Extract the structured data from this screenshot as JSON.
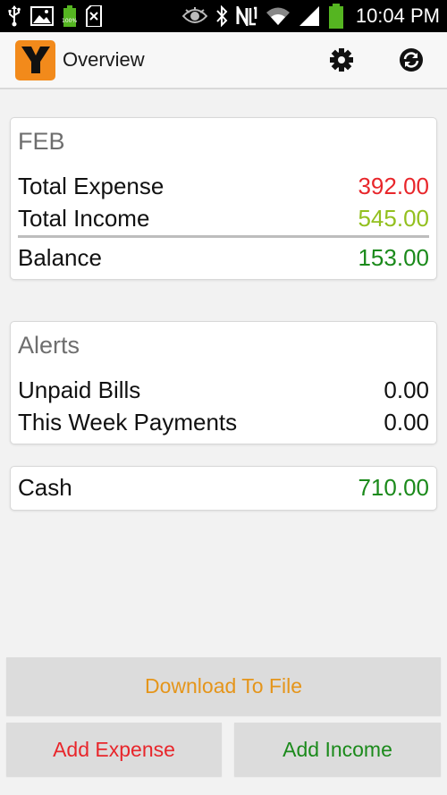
{
  "status_bar": {
    "battery_small_pct": "100%",
    "time": "10:04 PM"
  },
  "action_bar": {
    "logo_letter": "Y",
    "title": "Overview"
  },
  "month_card": {
    "title": "FEB",
    "rows": [
      {
        "label": "Total Expense",
        "value": "392.00"
      },
      {
        "label": "Total Income",
        "value": "545.00"
      }
    ],
    "balance": {
      "label": "Balance",
      "value": "153.00"
    }
  },
  "alerts_card": {
    "title": "Alerts",
    "rows": [
      {
        "label": "Unpaid Bills",
        "value": "0.00"
      },
      {
        "label": "This Week Payments",
        "value": "0.00"
      }
    ]
  },
  "cash_card": {
    "label": "Cash",
    "value": "710.00"
  },
  "buttons": {
    "download": "Download To File",
    "add_expense": "Add Expense",
    "add_income": "Add Income"
  },
  "colors": {
    "expense": "#e8262b",
    "income": "#93c01f",
    "balance": "#1b8a1b",
    "download": "#e5951a",
    "add_income": "#1b8a1b",
    "logo_bg": "#f28a1b"
  },
  "icons": {
    "usb": "usb-icon",
    "gallery": "gallery-icon",
    "battery_small": "battery-small-icon",
    "sd_card": "sd-card-icon",
    "eye": "eye-icon",
    "bluetooth": "bluetooth-icon",
    "nfc": "nfc-icon",
    "wifi": "wifi-icon",
    "signal": "signal-icon",
    "battery": "battery-icon",
    "settings": "gear-icon",
    "refresh": "sync-icon"
  }
}
